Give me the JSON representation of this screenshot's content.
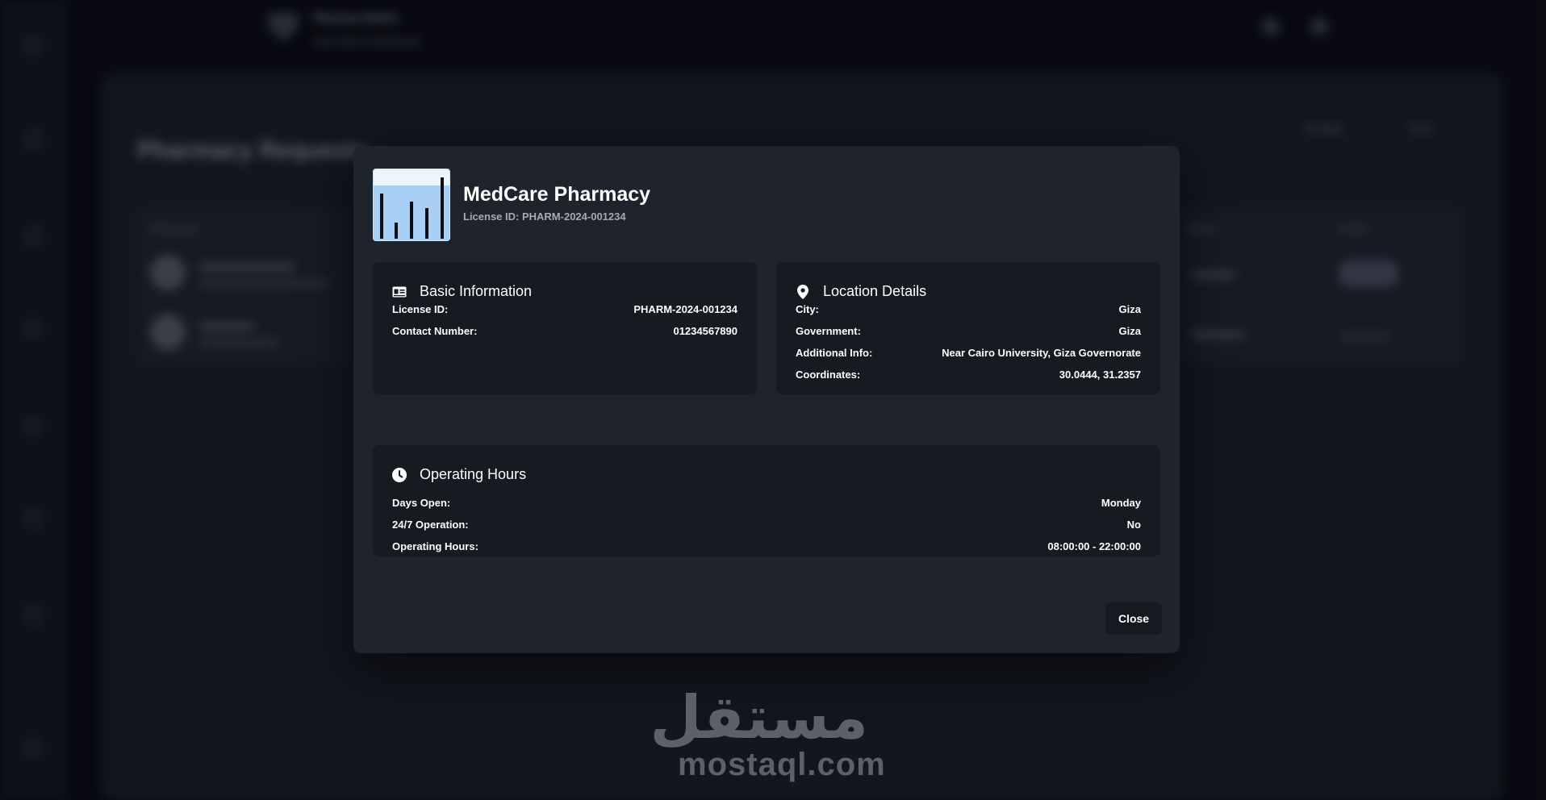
{
  "background": {
    "app_title": "Pharma Admin",
    "app_subtitle": "Sub-Admin Dashboard",
    "page_heading": "Pharmacy Requests",
    "stats": [
      {
        "label": "Pending"
      },
      {
        "label": "Total"
      }
    ],
    "table_headers": [
      "Pharmacy",
      "Status",
      "Action"
    ],
    "rows": [
      {
        "status": "Pending"
      },
      {
        "status": "Approved"
      }
    ]
  },
  "modal": {
    "pharmacy_name": "MedCare Pharmacy",
    "license_caption": "License ID: PHARM-2024-001234",
    "basic_info": {
      "title": "Basic Information",
      "icon": "id-card-icon",
      "rows": [
        {
          "label": "License ID:",
          "value": "PHARM-2024-001234"
        },
        {
          "label": "Contact Number:",
          "value": "01234567890"
        }
      ]
    },
    "location": {
      "title": "Location Details",
      "icon": "map-pin-icon",
      "rows": [
        {
          "label": "City:",
          "value": "Giza"
        },
        {
          "label": "Government:",
          "value": "Giza"
        },
        {
          "label": "Additional Info:",
          "value": "Near Cairo University, Giza Governorate"
        },
        {
          "label": "Coordinates:",
          "value": "30.0444, 31.2357"
        }
      ]
    },
    "hours": {
      "title": "Operating Hours",
      "icon": "clock-icon",
      "rows": [
        {
          "label": "Days Open:",
          "value": "Monday"
        },
        {
          "label": "24/7 Operation:",
          "value": "No"
        },
        {
          "label": "Operating Hours:",
          "value": "08:00:00 - 22:00:00"
        }
      ]
    },
    "close_label": "Close"
  },
  "watermark": {
    "arabic": "مستقل",
    "latin": "mostaql.com"
  },
  "colors": {
    "modal_bg": "#1e232c",
    "card_bg": "#161a21",
    "logo_blue": "#a8cff5"
  }
}
